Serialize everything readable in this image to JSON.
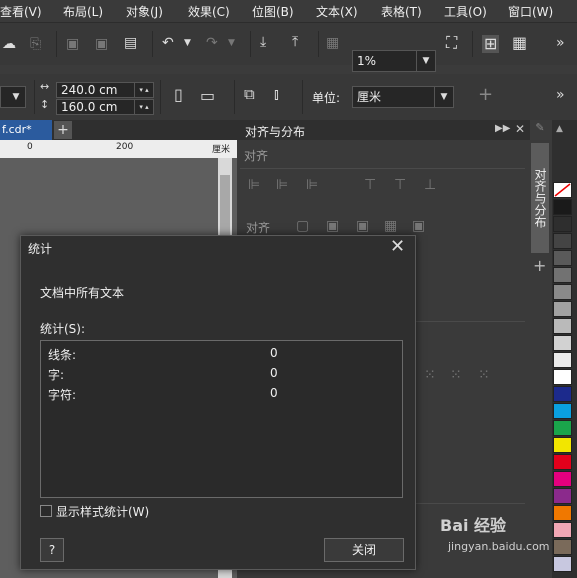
{
  "menubar": {
    "items": [
      "查看(V)",
      "布局(L)",
      "对象(J)",
      "效果(C)",
      "位图(B)",
      "文本(X)",
      "表格(T)",
      "工具(O)",
      "窗口(W)"
    ]
  },
  "toolbar": {
    "zoom_value": "1%",
    "width_value": "240.0 cm",
    "height_value": "160.0 cm",
    "unit_label": "单位:",
    "unit_value": "厘米"
  },
  "document": {
    "tab_label": "f.cdr*",
    "ruler_labels": [
      "0",
      "200",
      "厘米"
    ]
  },
  "panel": {
    "title": "对齐与分布",
    "section_align": "对齐",
    "section_distribute_prefix": "对齐",
    "vertical_tab": "对齐与分布"
  },
  "palette": {
    "colors": [
      "#ffffff",
      "#1a1a1a",
      "#2e2e2e",
      "#444444",
      "#5a5a5a",
      "#727272",
      "#8a8a8a",
      "#a2a2a2",
      "#bababa",
      "#d2d2d2",
      "#ebebeb",
      "#ffffff",
      "#1c2a8c",
      "#0aa0e0",
      "#1aa54b",
      "#f2e600",
      "#e3001b",
      "#e4007f",
      "#8b2a8c",
      "#f07800",
      "#f2a6b4",
      "#7a6a5a",
      "#c8c8e0"
    ]
  },
  "dialog": {
    "title": "统计",
    "heading": "文档中所有文本",
    "stats_label": "统计(S):",
    "rows": [
      {
        "label": "线条:",
        "value": "0"
      },
      {
        "label": "字:",
        "value": "0"
      },
      {
        "label": "字符:",
        "value": "0"
      }
    ],
    "checkbox_label": "显示样式统计(W)",
    "help_label": "?",
    "close_label": "关闭"
  },
  "watermark": {
    "text": "Bai 经验",
    "url": "jingyan.baidu.com"
  }
}
